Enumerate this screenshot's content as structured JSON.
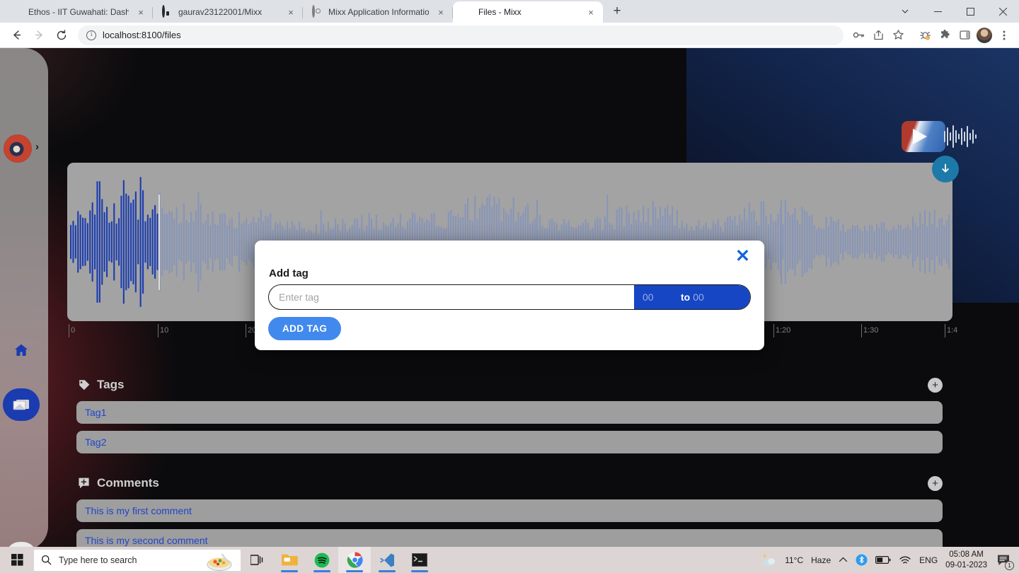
{
  "browser": {
    "tabs": [
      {
        "title": "Ethos - IIT Guwahati: Dashboard",
        "favicon": "ethos-icon",
        "active": false
      },
      {
        "title": "gaurav23122001/Mixx",
        "favicon": "github-icon",
        "active": false
      },
      {
        "title": "Mixx Application Information",
        "favicon": "info-icon",
        "active": false
      },
      {
        "title": "Files - Mixx",
        "favicon": "mixx-icon",
        "active": true
      }
    ],
    "new_tab_label": "+",
    "close_tab_label": "×",
    "window_controls": {
      "minimize": "—",
      "maximize": "❐",
      "close": "✕",
      "tab_search": "⌄"
    },
    "nav": {
      "back": "←",
      "forward": "→",
      "reload": "↻"
    },
    "omnibox": {
      "url": "localhost:8100/files",
      "site_info_icon": "info-circle-icon"
    },
    "toolbar_icons": [
      "key-icon",
      "share-icon",
      "bookmark-star-icon",
      "bug-extension-icon",
      "puzzle-extensions-icon",
      "side-panel-icon",
      "profile-avatar-icon",
      "kebab-menu-icon"
    ]
  },
  "app": {
    "sidebar": {
      "avatar_name": "user-avatar",
      "expand_label": "›",
      "items": [
        {
          "name": "home",
          "icon": "home-icon"
        },
        {
          "name": "files",
          "icon": "files-icon",
          "selected": true
        },
        {
          "name": "logout",
          "icon": "logout-icon"
        }
      ]
    },
    "brand": {
      "logo_name": "mixx-logo",
      "download_icon": "download-arrow-icon"
    },
    "player": {
      "playhead_seconds": 10,
      "ruler_labels": [
        "0",
        "10",
        "20",
        "1:20",
        "1:30",
        "1:4"
      ]
    },
    "tags_section": {
      "title": "Tags",
      "icon": "tag-icon",
      "add_label": "+",
      "items": [
        "Tag1",
        "Tag2"
      ]
    },
    "comments_section": {
      "title": "Comments",
      "icon": "comment-add-icon",
      "add_label": "+",
      "items": [
        "This is my first comment",
        "This is my second comment"
      ]
    },
    "modal": {
      "title": "Add tag",
      "close_label": "✕",
      "tag_placeholder": "Enter tag",
      "tag_value": "",
      "time_start": "00",
      "time_separator": "to",
      "time_end": "00",
      "submit_label": "ADD TAG"
    },
    "colors": {
      "accent_blue": "#1746c4",
      "button_blue": "#4289ed",
      "waveform_played": "#1a3cb0",
      "waveform_unplayed": "#8795b8",
      "panel_grey": "#a3a3a3",
      "row_grey": "#9e9e9e",
      "link_blue": "#2145c7"
    }
  },
  "taskbar": {
    "start_label": "start-icon",
    "search_placeholder": "Type here to search",
    "search_icon": "search-icon",
    "apps": [
      "task-view-icon",
      "file-explorer-icon",
      "spotify-icon",
      "chrome-icon",
      "vscode-icon",
      "terminal-icon"
    ],
    "tray": {
      "weather_temp": "11°C",
      "weather_desc": "Haze",
      "weather_icon": "partly-cloudy-night-icon",
      "overflow_icon": "chevron-up-icon",
      "bluetooth_icon": "bluetooth-icon",
      "battery_icon": "battery-icon",
      "wifi_icon": "wifi-icon",
      "language": "ENG",
      "time": "05:08 AM",
      "date": "09-01-2023",
      "notification_icon": "notification-icon",
      "notification_count": "1"
    }
  }
}
